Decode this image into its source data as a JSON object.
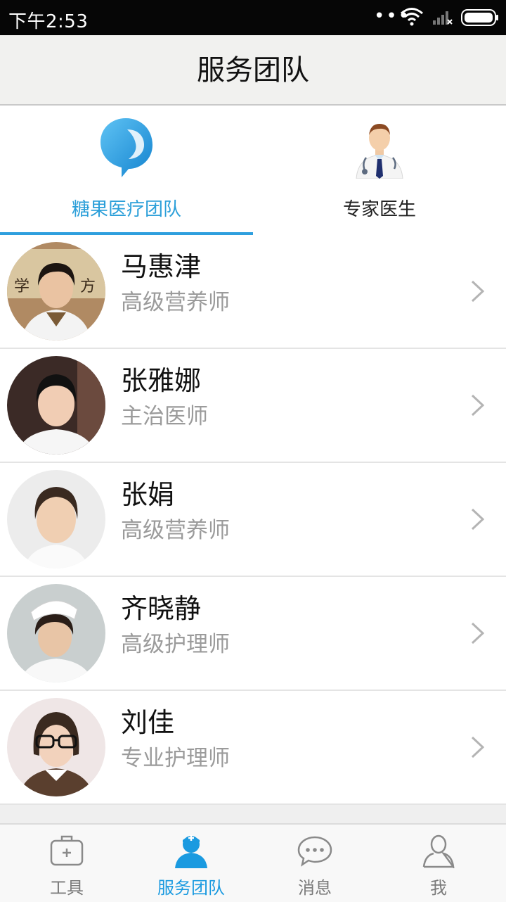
{
  "status_bar": {
    "time": "下午2:53",
    "dots": "•••"
  },
  "header": {
    "title": "服务团队"
  },
  "tabs": [
    {
      "label": "糖果医疗团队",
      "icon": "candy-logo-icon",
      "active": true
    },
    {
      "label": "专家医生",
      "icon": "doctor-icon",
      "active": false
    }
  ],
  "members": [
    {
      "name": "马惠津",
      "role": "高级营养师"
    },
    {
      "name": "张雅娜",
      "role": "主治医师"
    },
    {
      "name": "张娟",
      "role": "高级营养师"
    },
    {
      "name": "齐晓静",
      "role": "高级护理师"
    },
    {
      "name": "刘佳",
      "role": "专业护理师"
    }
  ],
  "bottom_nav": [
    {
      "label": "工具",
      "icon": "toolbox-icon",
      "active": false
    },
    {
      "label": "服务团队",
      "icon": "nurse-person-icon",
      "active": true
    },
    {
      "label": "消息",
      "icon": "chat-bubble-icon",
      "active": false
    },
    {
      "label": "我",
      "icon": "user-icon",
      "active": false
    }
  ],
  "colors": {
    "accent": "#2e9fde",
    "status_bar": "#060606",
    "header_bg": "#f1f1ef",
    "secondary_text": "#9b9b9b"
  }
}
